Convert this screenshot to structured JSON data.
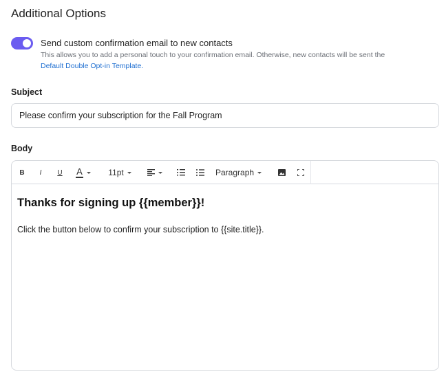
{
  "section": {
    "title": "Additional Options"
  },
  "custom_email_toggle": {
    "label": "Send custom confirmation email to new contacts",
    "help_text": "This allows you to add a personal touch to your confirmation email. Otherwise, new contacts will be sent the",
    "help_link": "Default Double Opt-in Template.",
    "enabled": true,
    "accent_color": "#6b5cf0"
  },
  "subject": {
    "label": "Subject",
    "value": "Please confirm your subscription for the Fall Program"
  },
  "body": {
    "label": "Body",
    "toolbar": {
      "bold": "B",
      "italic": "I",
      "underline": "U",
      "font_color": "A",
      "font_size": "11pt",
      "block_format": "Paragraph",
      "icons": [
        "align-left-icon",
        "numbered-list-icon",
        "bullet-list-icon",
        "image-icon",
        "fullscreen-icon"
      ]
    },
    "content": {
      "heading": "Thanks for signing up {{member}}!",
      "paragraph": "Click the button below to confirm your subscription to {{site.title}}."
    }
  }
}
